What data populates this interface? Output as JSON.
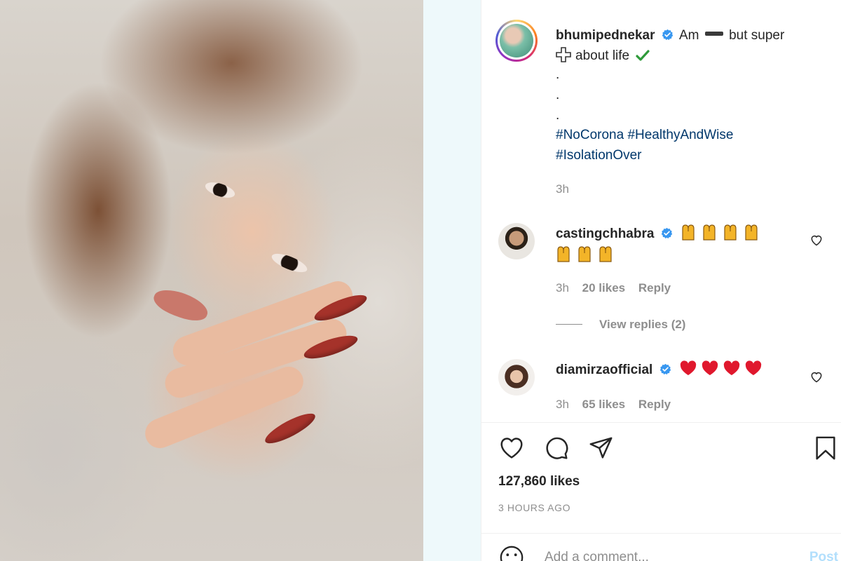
{
  "post": {
    "author": "bhumipednekar",
    "caption_part1": "Am",
    "caption_part2": "but super",
    "caption_part3": "about life",
    "dots": [
      ".",
      ".",
      "."
    ],
    "hashtags": [
      "#NoCorona",
      "#HealthyAndWise",
      "#IsolationOver"
    ],
    "caption_time": "3h"
  },
  "comments": [
    {
      "username": "castingchhabra",
      "time": "3h",
      "likes": "20 likes",
      "reply": "Reply",
      "view_replies": "View replies (2)"
    },
    {
      "username": "diamirzaofficial",
      "time": "3h",
      "likes": "65 likes",
      "reply": "Reply"
    }
  ],
  "footer": {
    "likes": "127,860 likes",
    "time": "3 HOURS AGO",
    "add_comment_placeholder": "Add a comment...",
    "post_label": "Post"
  },
  "icons": {
    "like": "heart-icon",
    "comment": "comment-icon",
    "share": "paper-plane-icon",
    "save": "bookmark-icon",
    "emoji": "smiley-icon"
  },
  "colors": {
    "hashtag": "#00376b",
    "verified": "#3897f0",
    "muted": "#8e8e8e",
    "post_button": "#b2dffc"
  }
}
